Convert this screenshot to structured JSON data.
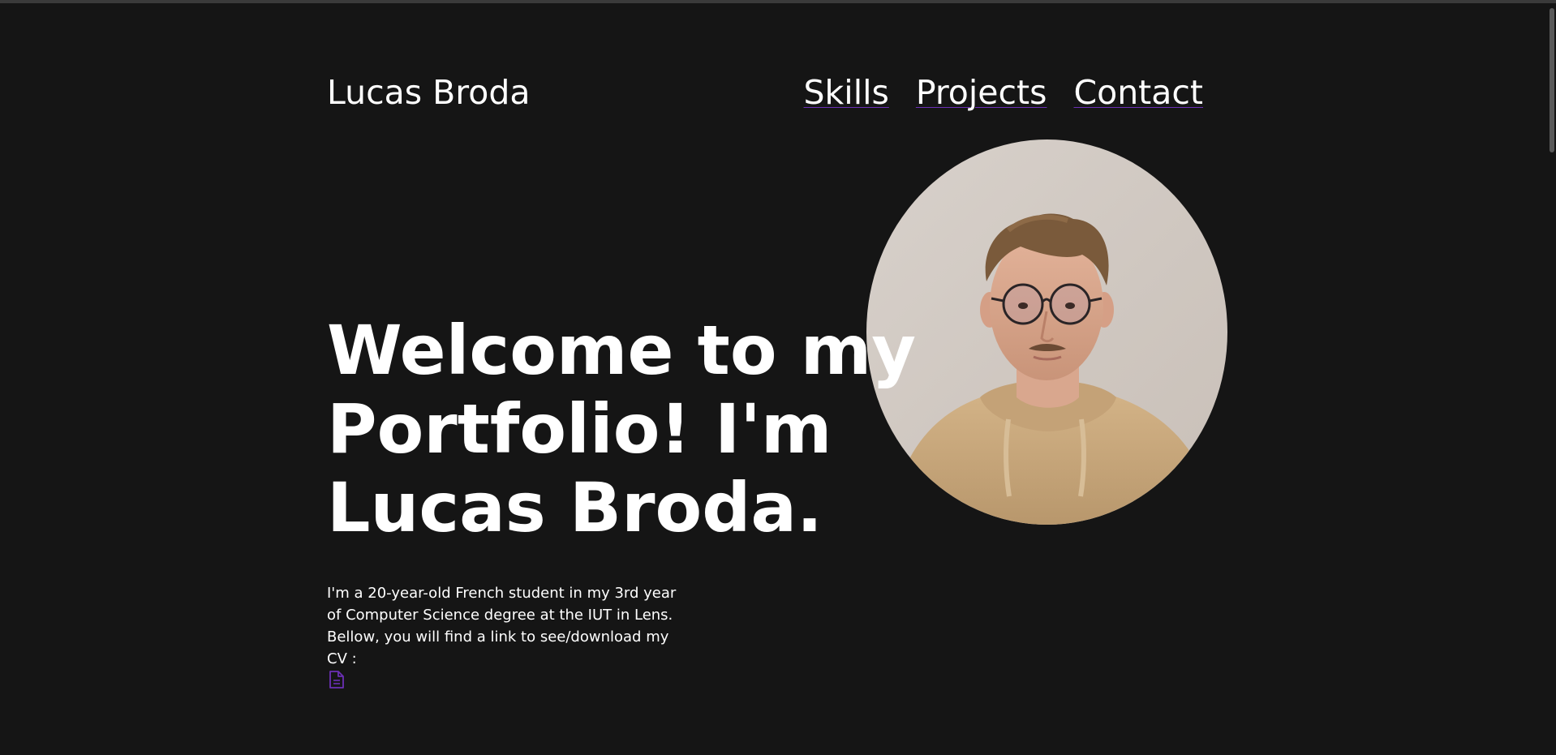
{
  "header": {
    "logo": "Lucas Broda",
    "nav": [
      {
        "label": "Skills"
      },
      {
        "label": "Projects"
      },
      {
        "label": "Contact"
      }
    ]
  },
  "hero": {
    "title": "Welcome to my Portfolio! I'm Lucas Broda.",
    "intro": "I'm a 20-year-old French student in my 3rd year of Computer Science degree at the IUT in Lens. Bellow, you will find a link to see/download my CV :",
    "cv_icon": "document-icon",
    "photo": "profile-photo"
  },
  "colors": {
    "background": "#151515",
    "text": "#ffffff",
    "accent": "#6b2fb5"
  }
}
